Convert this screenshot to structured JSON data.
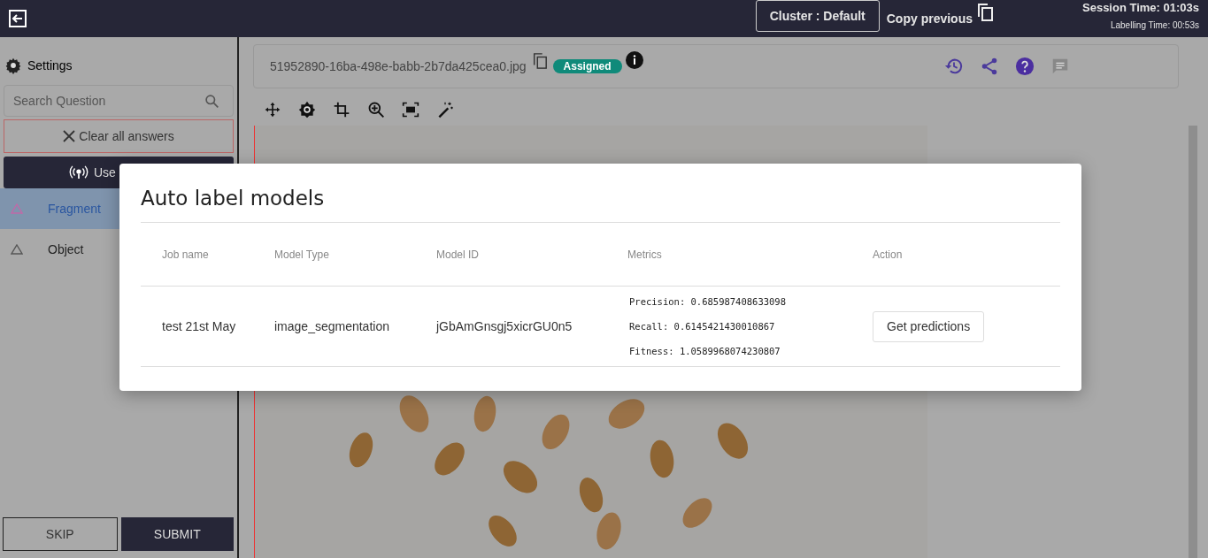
{
  "top_bar": {
    "cluster_button": "Cluster : Default",
    "copy_previous": "Copy previous",
    "session_time": "Session Time: 01:03s",
    "labelling_time": "Labelling Time: 00:53s"
  },
  "sidebar": {
    "settings": "Settings",
    "search": {
      "placeholder": "Search Question"
    },
    "clear_button": "Clear all answers",
    "use_button": "Use",
    "items": [
      {
        "label": "Fragment",
        "selected": true,
        "color": "#c06aa8"
      },
      {
        "label": "Object",
        "selected": false,
        "color": "#555555"
      }
    ],
    "skip_button": "SKIP",
    "submit_button": "SUBMIT"
  },
  "file_header": {
    "file_name": "51952890-16ba-498e-babb-2b7da425cea0.jpg",
    "status_badge": "Assigned"
  },
  "dialog": {
    "title": "Auto label models",
    "columns": [
      "Job name",
      "Model Type",
      "Model ID",
      "Metrics",
      "Action"
    ],
    "rows": [
      {
        "job_name": "test 21st May",
        "model_type": "image_segmentation",
        "model_id": "jGbAmGnsgj5xicrGU0n5",
        "metrics": [
          "Precision: 0.685987408633098",
          "Recall: 0.6145421430010867",
          "Fitness: 1.0589968074230807"
        ],
        "action": "Get predictions"
      }
    ]
  }
}
